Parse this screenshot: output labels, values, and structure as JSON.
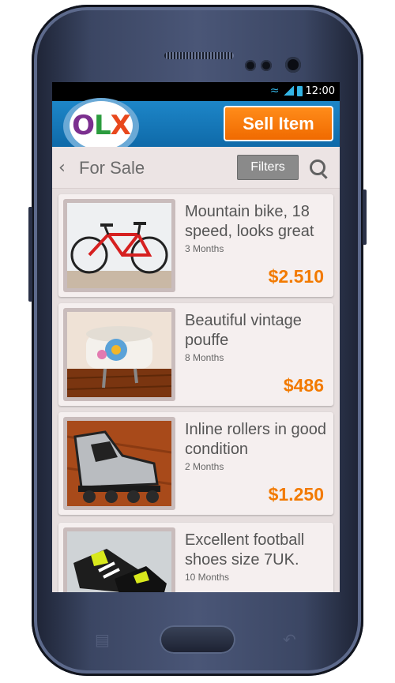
{
  "status_bar": {
    "time": "12:00",
    "icons": [
      "wifi-icon",
      "signal-icon",
      "battery-icon"
    ]
  },
  "header": {
    "logo": {
      "o": "O",
      "l": "L",
      "x": "X"
    },
    "sell_button": "Sell Item"
  },
  "subheader": {
    "back_icon": "chevron-left-icon",
    "title": "For Sale",
    "filters_button": "Filters",
    "search_icon": "search-icon"
  },
  "listings": [
    {
      "title": "Mountain bike, 18 speed, looks great",
      "age": "3 Months",
      "price": "$2.510",
      "image": "bicycle"
    },
    {
      "title": "Beautiful vintage pouffe",
      "age": "8 Months",
      "price": "$486",
      "image": "pouffe"
    },
    {
      "title": "Inline rollers in good condition",
      "age": "2 Months",
      "price": "$1.250",
      "image": "rollers"
    },
    {
      "title": "Excellent football shoes size 7UK.",
      "age": "10 Months",
      "price": "",
      "image": "football-shoes"
    }
  ],
  "colors": {
    "accent": "#f27a00",
    "topbar": "#1579bb",
    "sell": "#ff7a00"
  }
}
